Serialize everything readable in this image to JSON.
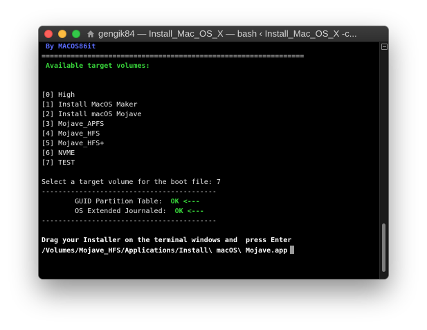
{
  "window": {
    "title": "gengik84 — Install_Mac_OS_X — bash ‹ Install_Mac_OS_X -c..."
  },
  "terminal": {
    "byline": " By MACOS86it",
    "separator_long": "===============================================================",
    "available_header": " Available target volumes:",
    "volumes": [
      "[0] High",
      "[1] Install MacOS Maker",
      "[2] Install macOS Mojave",
      "[3] Mojave_APFS",
      "[4] Mojave_HFS",
      "[5] Mojave_HFS+",
      "[6] NVME",
      "[7] TEST"
    ],
    "select_prompt": "Select a target volume for the boot file: 7",
    "separator_short": "------------------------------------------",
    "guid_label": "        GUID Partition Table:  ",
    "guid_status": "OK <---",
    "os_label": "        OS Extended Journaled:  ",
    "os_status": "OK <---",
    "drag_instruction": "Drag your Installer on the terminal windows and  press Enter",
    "path_input": "/Volumes/Mojave_HFS/Applications/Install\\ macOS\\ Mojave.app"
  },
  "colors": {
    "byline": "#5b6cff",
    "ok": "#37d43a",
    "background": "#000000"
  }
}
